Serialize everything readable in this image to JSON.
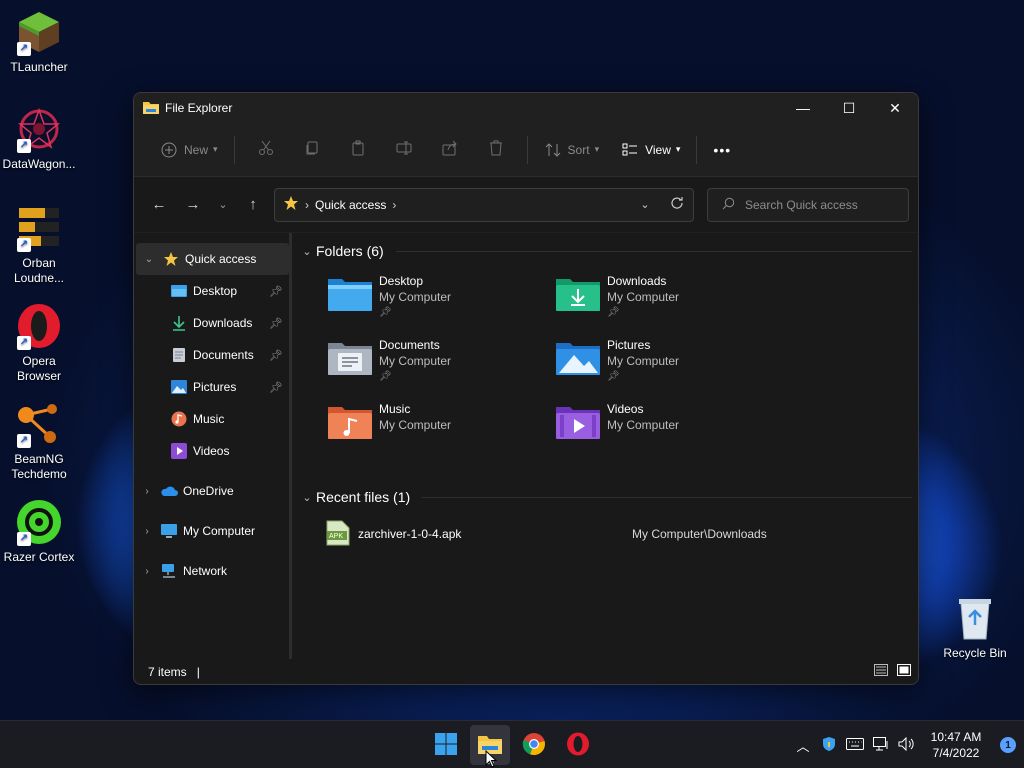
{
  "desktop": {
    "icons": [
      {
        "label": "TLauncher",
        "icon": "minecraft-grass-block-icon"
      },
      {
        "label": "DataWagon...",
        "icon": "datawagon-icon"
      },
      {
        "label": "Orban Loudne...",
        "icon": "orban-loudness-meter-icon"
      },
      {
        "label": "Opera Browser",
        "icon": "opera-icon"
      },
      {
        "label": "BeamNG Techdemo",
        "icon": "beamng-icon"
      },
      {
        "label": "Razer Cortex",
        "icon": "razer-cortex-icon"
      }
    ],
    "recycle_bin": {
      "label": "Recycle Bin",
      "icon": "recycle-bin-icon"
    }
  },
  "window": {
    "title": "File Explorer",
    "controls": {
      "minimize": "—",
      "maximize": "☐",
      "close": "✕"
    }
  },
  "command_bar": {
    "new_label": "New",
    "sort_label": "Sort",
    "view_label": "View",
    "more_label": "•••"
  },
  "address": {
    "crumb": "Quick access",
    "search_placeholder": "Search Quick access"
  },
  "nav": {
    "items": [
      {
        "label": "Quick access",
        "icon": "star-icon",
        "level": 0,
        "expanded": true,
        "selected": true
      },
      {
        "label": "Desktop",
        "icon": "desktop-folder-icon",
        "level": 1,
        "pinned": true
      },
      {
        "label": "Downloads",
        "icon": "download-icon",
        "level": 1,
        "pinned": true
      },
      {
        "label": "Documents",
        "icon": "document-icon",
        "level": 1,
        "pinned": true
      },
      {
        "label": "Pictures",
        "icon": "pictures-icon",
        "level": 1,
        "pinned": true
      },
      {
        "label": "Music",
        "icon": "music-icon",
        "level": 1
      },
      {
        "label": "Videos",
        "icon": "videos-icon",
        "level": 1
      },
      {
        "label": "OneDrive",
        "icon": "onedrive-cloud-icon",
        "level": 0
      },
      {
        "label": "My Computer",
        "icon": "computer-icon",
        "level": 0
      },
      {
        "label": "Network",
        "icon": "network-icon",
        "level": 0
      }
    ]
  },
  "folders_group": {
    "header": "Folders (6)",
    "items": [
      {
        "name": "Desktop",
        "location": "My Computer",
        "pinned": true,
        "icon": "desktop-folder-icon"
      },
      {
        "name": "Downloads",
        "location": "My Computer",
        "pinned": true,
        "icon": "downloads-folder-icon"
      },
      {
        "name": "Documents",
        "location": "My Computer",
        "pinned": true,
        "icon": "documents-folder-icon"
      },
      {
        "name": "Pictures",
        "location": "My Computer",
        "pinned": true,
        "icon": "pictures-folder-icon"
      },
      {
        "name": "Music",
        "location": "My Computer",
        "pinned": false,
        "icon": "music-folder-icon"
      },
      {
        "name": "Videos",
        "location": "My Computer",
        "pinned": false,
        "icon": "videos-folder-icon"
      }
    ]
  },
  "recent_group": {
    "header": "Recent files (1)",
    "items": [
      {
        "name": "zarchiver-1-0-4.apk",
        "location": "My Computer\\Downloads",
        "icon": "apk-file-icon"
      }
    ]
  },
  "status": {
    "count": "7 items",
    "caret": "|"
  },
  "taskbar": {
    "apps": [
      "start-icon",
      "file-explorer-icon",
      "chrome-icon",
      "opera-icon"
    ],
    "time": "10:47 AM",
    "date": "7/4/2022",
    "notification_count": "1"
  },
  "colors": {
    "accent": "#4cc2ff",
    "window_bg": "#202020",
    "content_bg": "#191919",
    "folder_yellow": "#f4c542"
  }
}
